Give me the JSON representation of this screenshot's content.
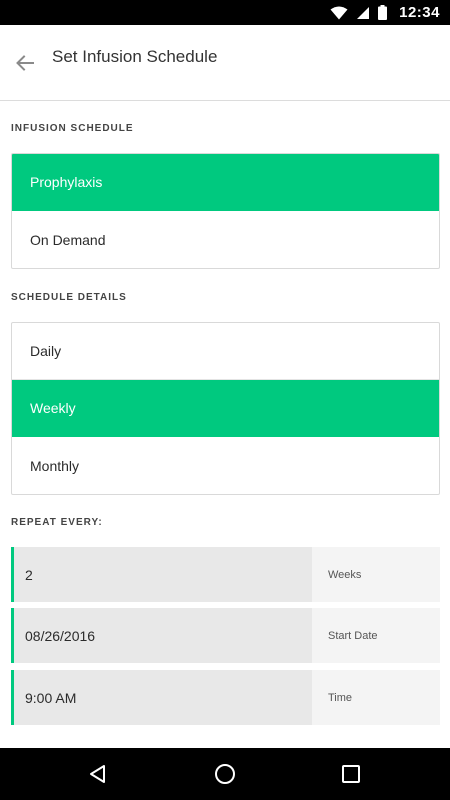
{
  "status_bar": {
    "time": "12:34"
  },
  "header": {
    "title": "Set Infusion Schedule"
  },
  "infusion_schedule": {
    "label": "INFUSION SCHEDULE",
    "options": [
      {
        "label": "Prophylaxis",
        "selected": true
      },
      {
        "label": "On Demand",
        "selected": false
      }
    ]
  },
  "schedule_details": {
    "label": "SCHEDULE DETAILS",
    "options": [
      {
        "label": "Daily",
        "selected": false
      },
      {
        "label": "Weekly",
        "selected": true
      },
      {
        "label": "Monthly",
        "selected": false
      }
    ]
  },
  "repeat_every": {
    "label": "REPEAT EVERY:",
    "fields": [
      {
        "value": "2",
        "unit": "Weeks"
      },
      {
        "value": "08/26/2016",
        "unit": "Start Date"
      },
      {
        "value": "9:00 AM",
        "unit": "Time"
      }
    ]
  },
  "colors": {
    "accent": "#00c97f",
    "field_bg": "#e8e8e8"
  },
  "icons": {
    "back": "arrow-left-icon",
    "wifi": "wifi-icon",
    "signal": "cell-signal-icon",
    "battery": "battery-icon",
    "nav_back": "triangle-back-icon",
    "nav_home": "circle-home-icon",
    "nav_recents": "square-recents-icon"
  }
}
